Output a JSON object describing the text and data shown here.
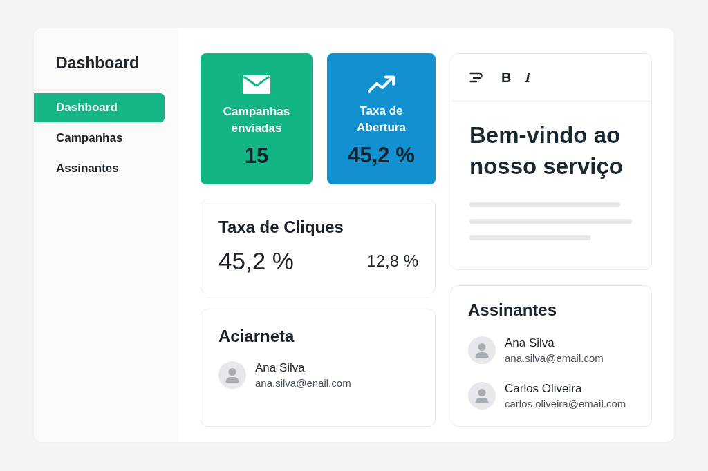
{
  "sidebar": {
    "title": "Dashboard",
    "items": [
      {
        "label": "Dashboard",
        "selected": true
      },
      {
        "label": "Campanhas",
        "selected": false
      },
      {
        "label": "Assinantes",
        "selected": false
      }
    ]
  },
  "stat_cards": [
    {
      "label": "Campanhas enviadas",
      "value": "15",
      "color": "#13b584"
    },
    {
      "label": "Taxa de Abertura",
      "value": "45,2 %",
      "color": "#1290d0"
    }
  ],
  "click_rate_card": {
    "title": "Taxa de Cliques",
    "value": "45,2 %",
    "secondary_value": "12,8 %"
  },
  "contacts_card": {
    "title": "Aciarneta",
    "contacts": [
      {
        "name": "Ana Silva",
        "email": "ana.silva@enail.com"
      }
    ]
  },
  "editor": {
    "toolbar": [
      {
        "kind": "align"
      },
      {
        "kind": "bold",
        "label": "B"
      },
      {
        "kind": "italic",
        "label": "I"
      }
    ],
    "heading": "Bem-vindo ao nosso serviço"
  },
  "subscribers_card": {
    "title": "Assinantes",
    "contacts": [
      {
        "name": "Ana Silva",
        "email": "ana.silva@email.com"
      },
      {
        "name": "Carlos Oliveira",
        "email": "carlos.oliveira@email.com"
      }
    ]
  }
}
